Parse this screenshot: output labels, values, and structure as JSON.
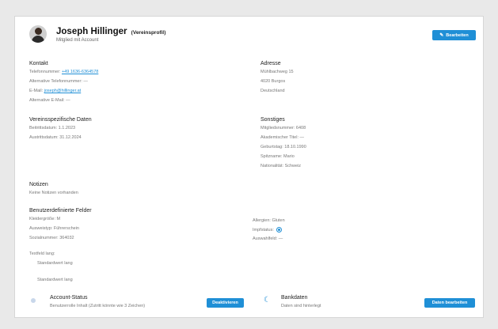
{
  "header": {
    "name": "Joseph Hillinger",
    "role": "(Vereinsprofil)",
    "subtitle": "Mitglied mit Account",
    "edit_label": "Bearbeiten",
    "edit_icon": "pencil-icon"
  },
  "contact": {
    "title": "Kontakt",
    "phone_label": "Telefonnummer:",
    "phone_value": "+49 1636-6364578",
    "alt_phone": "Alternative Telefonnummer: —",
    "email_label": "E-Mail:",
    "email_value": "joseph@hillinger.at",
    "alt_email": "Alternative E-Mail: —"
  },
  "address": {
    "title": "Adresse",
    "street": "Mühlbachweg 15",
    "city": "4020 Burgos",
    "country": "Deutschland"
  },
  "club": {
    "title": "Vereinsspezifische Daten",
    "entry": "Beitrittsdatum: 1.1.2023",
    "exit": "Austrittsdatum: 31.12.2024"
  },
  "other": {
    "title": "Sonstiges",
    "member_no": "Mitgliedsnummer: 6408",
    "title_field": "Akademischer Titel: —",
    "birthday": "Geburtstag: 18.10.1990",
    "nickname": "Spitzname: Mario",
    "nationality": "Nationalität: Schweiz"
  },
  "notes": {
    "title": "Notizen",
    "value": "Keine Notizen vorhanden"
  },
  "custom": {
    "title": "Benutzerdefinierte Felder",
    "left": [
      "Kleidergröße: M",
      "Ausweistyp: Führerschein",
      "Sozialnummer: 364032"
    ],
    "right_allergies": "Allergien: Gluten",
    "right_checkbox_label": "Impfstatus:",
    "right_checkbox_checked": true,
    "right_misc": "Auswahlfeld: —",
    "long_label": "Textfeld lang:",
    "long_value_1": "Standardwert lang",
    "long_value_2": "Standardwert lang"
  },
  "account": {
    "title": "Account-Status",
    "subtitle": "Benutzerrolle Inhalt (Zutritt könnte wie 3 Zeichen)",
    "button": "Deaktivieren",
    "icon": "person-icon"
  },
  "bank": {
    "title": "Bankdaten",
    "subtitle": "Daten sind hinterlegt",
    "button": "Daten bearbeiten",
    "icon": "moon-icon"
  },
  "colors": {
    "accent": "#1f8fd6"
  }
}
